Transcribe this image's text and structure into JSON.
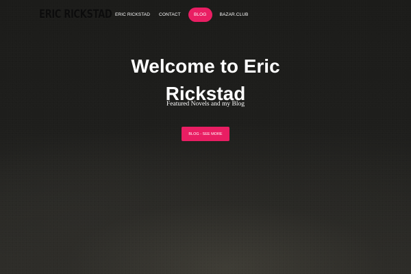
{
  "header": {
    "logo_text": "ERIC RICKSTAD",
    "nav": [
      {
        "label": "ERIC RICKSTAD",
        "active": false
      },
      {
        "label": "CONTACT",
        "active": false
      },
      {
        "label": "BLOG",
        "active": true
      },
      {
        "label": "BAZAR.CLUB",
        "active": false
      }
    ]
  },
  "hero": {
    "title_line1": "Welcome to Eric",
    "title_line2": "Rickstad",
    "subtitle": "Featured Novels and my Blog",
    "cta_label": "BLOG - SEE MORE"
  },
  "colors": {
    "accent": "#e91e63",
    "background": "#1f1f1d",
    "text": "#ffffff"
  }
}
